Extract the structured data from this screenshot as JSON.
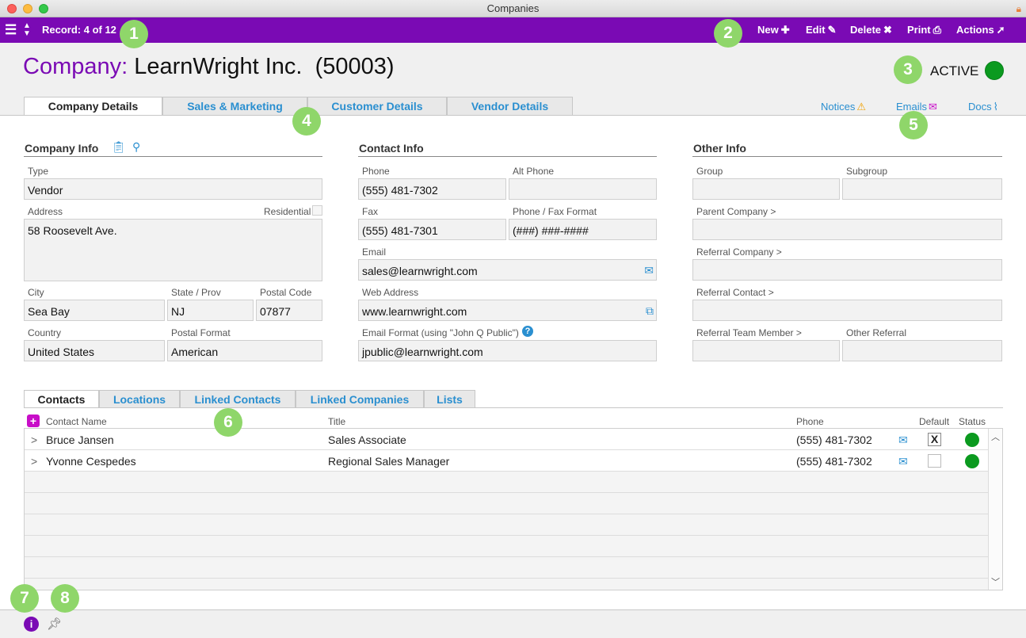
{
  "window": {
    "title": "Companies"
  },
  "toolbar": {
    "record": "Record: 4 of 12",
    "new_label": "New",
    "edit_label": "Edit",
    "delete_label": "Delete",
    "print_label": "Print",
    "actions_label": "Actions"
  },
  "header": {
    "label": "Company:",
    "name": "LearnWright Inc.",
    "id": "(50003)",
    "status": "ACTIVE",
    "status_color": "#0b9a1f"
  },
  "top_tabs": [
    {
      "label": "Company Details"
    },
    {
      "label": "Sales & Marketing"
    },
    {
      "label": "Customer Details"
    },
    {
      "label": "Vendor Details"
    }
  ],
  "side_links": {
    "notices": "Notices",
    "emails": "Emails",
    "docs": "Docs"
  },
  "company_info": {
    "title": "Company Info",
    "type_label": "Type",
    "type_value": "Vendor",
    "address_label": "Address",
    "residential_label": "Residential",
    "address_value": "58 Roosevelt Ave.",
    "city_label": "City",
    "city_value": "Sea Bay",
    "state_label": "State / Prov",
    "state_value": "NJ",
    "postal_label": "Postal Code",
    "postal_value": "07877",
    "country_label": "Country",
    "country_value": "United States",
    "postal_format_label": "Postal Format",
    "postal_format_value": "American"
  },
  "contact_info": {
    "title": "Contact Info",
    "phone_label": "Phone",
    "phone_value": "(555) 481-7302",
    "alt_phone_label": "Alt Phone",
    "alt_phone_value": "",
    "fax_label": "Fax",
    "fax_value": "(555) 481-7301",
    "format_label": "Phone / Fax Format",
    "format_value": "(###) ###-####",
    "email_label": "Email",
    "email_value": "sales@learnwright.com",
    "web_label": "Web Address",
    "web_value": "www.learnwright.com",
    "email_format_label": "Email Format (using \"John Q Public\")",
    "email_format_value": "jpublic@learnwright.com"
  },
  "other_info": {
    "title": "Other Info",
    "group_label": "Group",
    "subgroup_label": "Subgroup",
    "parent_label": "Parent Company >",
    "ref_company_label": "Referral Company >",
    "ref_contact_label": "Referral Contact >",
    "ref_team_label": "Referral Team Member >",
    "other_ref_label": "Other Referral"
  },
  "bottom_tabs": [
    {
      "label": "Contacts"
    },
    {
      "label": "Locations"
    },
    {
      "label": "Linked Contacts"
    },
    {
      "label": "Linked Companies"
    },
    {
      "label": "Lists"
    }
  ],
  "grid": {
    "columns": {
      "name": "Contact Name",
      "title": "Title",
      "phone": "Phone",
      "default": "Default",
      "status": "Status"
    },
    "rows": [
      {
        "name": "Bruce Jansen",
        "title": "Sales Associate",
        "phone": "(555) 481-7302",
        "default": "X"
      },
      {
        "name": "Yvonne Cespedes",
        "title": "Regional Sales Manager",
        "phone": "(555) 481-7302",
        "default": ""
      }
    ]
  },
  "badges": [
    "1",
    "2",
    "3",
    "4",
    "5",
    "6",
    "7",
    "8"
  ],
  "badge_color": "#8fd66a",
  "accent_color": "#7a0ab4"
}
